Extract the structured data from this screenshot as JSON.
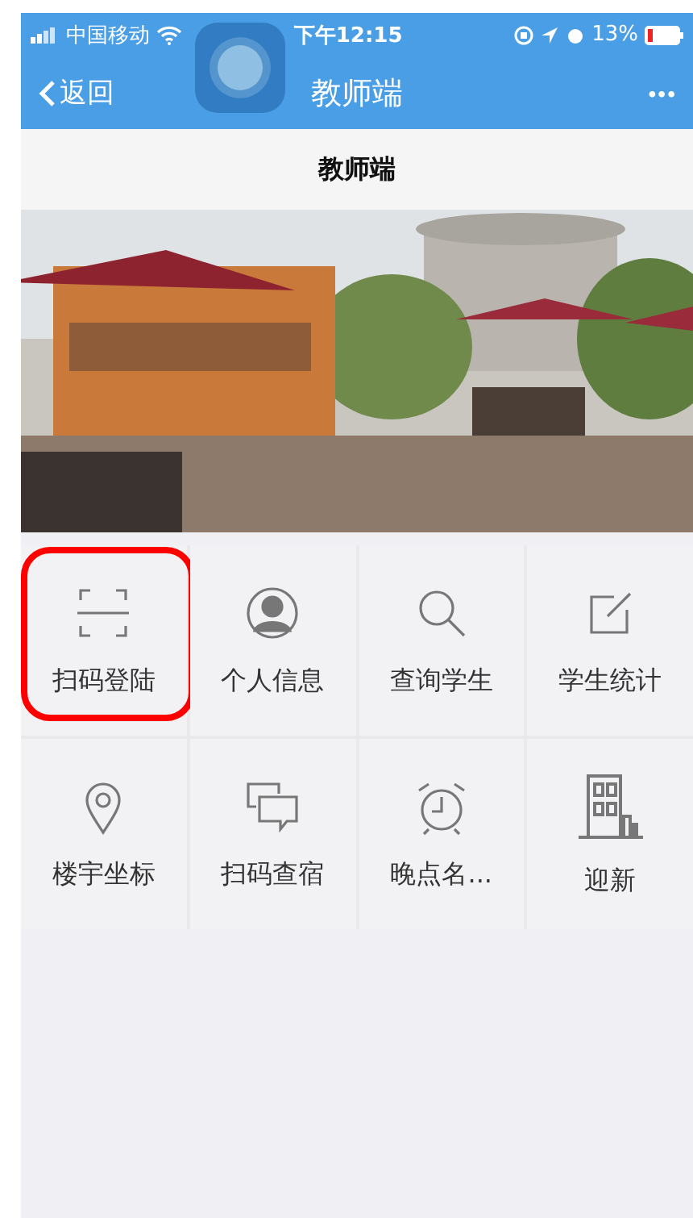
{
  "status_bar": {
    "carrier": "中国移动",
    "time": "下午12:15",
    "battery": "13%"
  },
  "nav_bar": {
    "back": "返回",
    "title": "教师端",
    "more": "•••"
  },
  "page_title": "教师端",
  "menu": [
    {
      "kind": "scan",
      "label": "扫码登陆",
      "highlighted": true
    },
    {
      "kind": "person",
      "label": "个人信息",
      "highlighted": false
    },
    {
      "kind": "search",
      "label": "查询学生",
      "highlighted": false
    },
    {
      "kind": "edit",
      "label": "学生统计",
      "highlighted": false
    },
    {
      "kind": "pin",
      "label": "楼宇坐标",
      "highlighted": false
    },
    {
      "kind": "chat",
      "label": "扫码查宿",
      "highlighted": false
    },
    {
      "kind": "alarm",
      "label": "晚点名...",
      "highlighted": false
    },
    {
      "kind": "building",
      "label": "迎新",
      "highlighted": false
    }
  ]
}
